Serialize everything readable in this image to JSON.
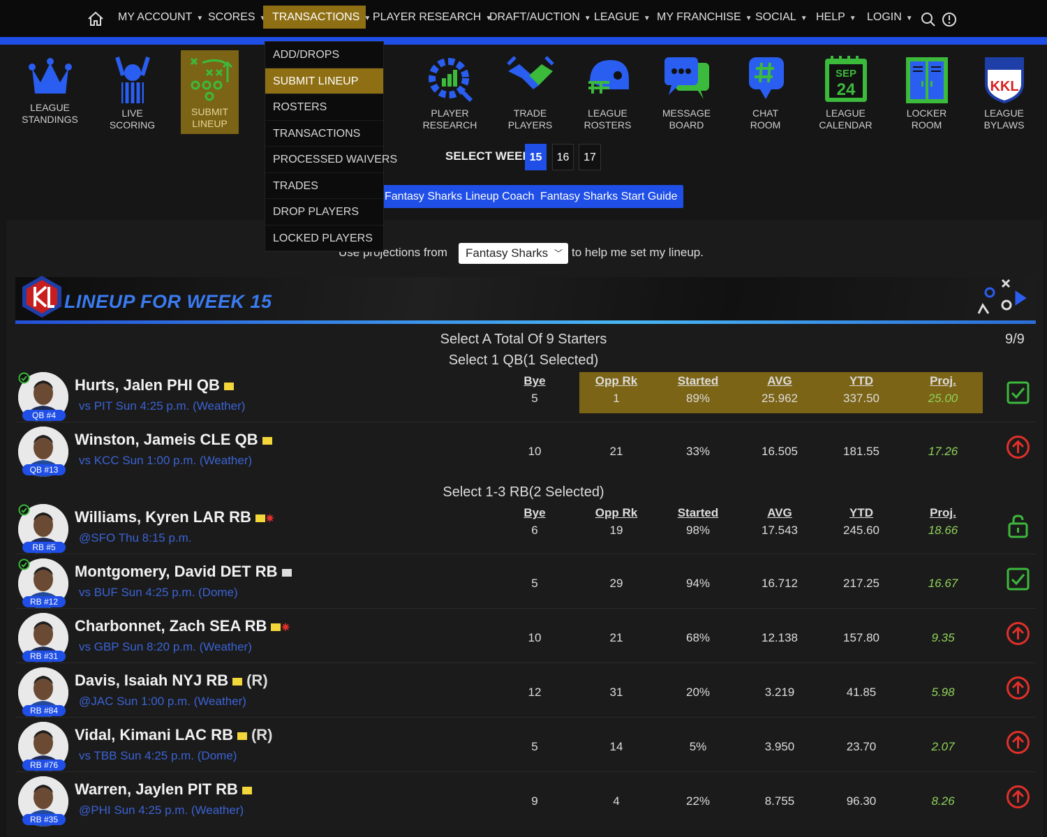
{
  "nav": {
    "items": [
      {
        "label": "MY ACCOUNT"
      },
      {
        "label": "SCORES"
      },
      {
        "label": "TRANSACTIONS"
      },
      {
        "label": "PLAYER RESEARCH"
      },
      {
        "label": "DRAFT/AUCTION"
      },
      {
        "label": "LEAGUE"
      },
      {
        "label": "MY FRANCHISE"
      },
      {
        "label": "SOCIAL"
      },
      {
        "label": "HELP"
      },
      {
        "label": "LOGIN"
      }
    ],
    "active": "TRANSACTIONS"
  },
  "dropdown": {
    "items": [
      "ADD/DROPS",
      "SUBMIT LINEUP",
      "ROSTERS",
      "TRANSACTIONS",
      "PROCESSED WAIVERS",
      "TRADES",
      "DROP PLAYERS",
      "LOCKED PLAYERS"
    ],
    "active": "SUBMIT LINEUP"
  },
  "tiles": [
    {
      "label": "LEAGUE\nSTANDINGS",
      "icon": "crown-icon"
    },
    {
      "label": "LIVE\nSCORING",
      "icon": "referee-icon"
    },
    {
      "label": "SUBMIT\nLINEUP",
      "icon": "playbook-icon"
    },
    {
      "label": "PLAYER\nRESEARCH",
      "icon": "gear-chart-icon"
    },
    {
      "label": "TRADE\nPLAYERS",
      "icon": "handshake-icon"
    },
    {
      "label": "LEAGUE\nROSTERS",
      "icon": "helmet-icon"
    },
    {
      "label": "MESSAGE\nBOARD",
      "icon": "chat-bubbles-icon"
    },
    {
      "label": "CHAT\nROOM",
      "icon": "hashtag-chat-icon"
    },
    {
      "label": "LEAGUE\nCALENDAR",
      "icon": "calendar-icon"
    },
    {
      "label": "LOCKER\nROOM",
      "icon": "locker-icon"
    },
    {
      "label": "LEAGUE\nBYLAWS",
      "icon": "league-shield-icon"
    }
  ],
  "calendar_icon_text": {
    "month": "SEP",
    "day": "24"
  },
  "bylaws_icon_text": "KKL",
  "week": {
    "label": "SELECT WEEK:",
    "options": [
      "15",
      "16",
      "17"
    ],
    "selected": "15"
  },
  "buttons": {
    "coach": "Fantasy Sharks Lineup Coach",
    "guide": "Fantasy Sharks Start Guide"
  },
  "projections": {
    "prefix": "Use projections from",
    "source": "Fantasy Sharks",
    "suffix": "to help me set my lineup."
  },
  "banner": {
    "title": "LINEUP FOR WEEK 15"
  },
  "lineup": {
    "starters_text": "Select A Total Of 9 Starters",
    "count": "9/9",
    "qb_text": "Select 1 QB(1 Selected)",
    "rb_text": "Select 1-3 RB(2 Selected)"
  },
  "columns": [
    "Bye",
    "Opp Rk",
    "Started",
    "AVG",
    "YTD",
    "Proj."
  ],
  "players": [
    {
      "name": "Hurts, Jalen PHI QB",
      "game": "vs PIT Sun 4:25 p.m. (Weather)",
      "badge": "QB #4",
      "bye": "5",
      "opp": "1",
      "started": "89%",
      "avg": "25.962",
      "ytd": "337.50",
      "proj": "25.00",
      "selected": true,
      "action": "checked-icon"
    },
    {
      "name": "Winston, Jameis CLE QB",
      "game": "vs KCC Sun 1:00 p.m. (Weather)",
      "badge": "QB #13",
      "bye": "10",
      "opp": "21",
      "started": "33%",
      "avg": "16.505",
      "ytd": "181.55",
      "proj": "17.26",
      "selected": false,
      "action": "promote-icon"
    },
    {
      "name": "Williams, Kyren LAR RB",
      "game": "@SFO Thu 8:15 p.m.",
      "badge": "RB #5",
      "bye": "6",
      "opp": "19",
      "started": "98%",
      "avg": "17.543",
      "ytd": "245.60",
      "proj": "18.66",
      "selected": true,
      "action": "lock-icon",
      "injury": true
    },
    {
      "name": "Montgomery, David DET RB",
      "game": "vs BUF Sun 4:25 p.m. (Dome)",
      "badge": "RB #12",
      "bye": "5",
      "opp": "29",
      "started": "94%",
      "avg": "16.712",
      "ytd": "217.25",
      "proj": "16.67",
      "selected": true,
      "action": "checked-icon",
      "grey_note": true
    },
    {
      "name": "Charbonnet, Zach SEA RB",
      "game": "vs GBP Sun 8:20 p.m. (Weather)",
      "badge": "RB #31",
      "bye": "10",
      "opp": "21",
      "started": "68%",
      "avg": "12.138",
      "ytd": "157.80",
      "proj": "9.35",
      "selected": false,
      "action": "promote-icon",
      "injury": true
    },
    {
      "name": "Davis, Isaiah NYJ RB",
      "game": "@JAC Sun 1:00 p.m. (Weather)",
      "badge": "RB #84",
      "bye": "12",
      "opp": "31",
      "started": "20%",
      "avg": "3.219",
      "ytd": "41.85",
      "proj": "5.98",
      "selected": false,
      "action": "promote-icon",
      "rookie": "(R)"
    },
    {
      "name": "Vidal, Kimani LAC RB",
      "game": "vs TBB Sun 4:25 p.m. (Dome)",
      "badge": "RB #76",
      "bye": "5",
      "opp": "14",
      "started": "5%",
      "avg": "3.950",
      "ytd": "23.70",
      "proj": "2.07",
      "selected": false,
      "action": "promote-icon",
      "rookie": "(R)"
    },
    {
      "name": "Warren, Jaylen PIT RB",
      "game": "@PHI Sun 4:25 p.m. (Weather)",
      "badge": "RB #35",
      "bye": "9",
      "opp": "4",
      "started": "22%",
      "avg": "8.755",
      "ytd": "96.30",
      "proj": "8.26",
      "selected": false,
      "action": "promote-icon"
    }
  ],
  "colors": {
    "accent": "#1f4fe6",
    "gold": "#7b6415",
    "green": "#3cba3c",
    "red": "#e0302a",
    "proj": "#8fd35a"
  }
}
